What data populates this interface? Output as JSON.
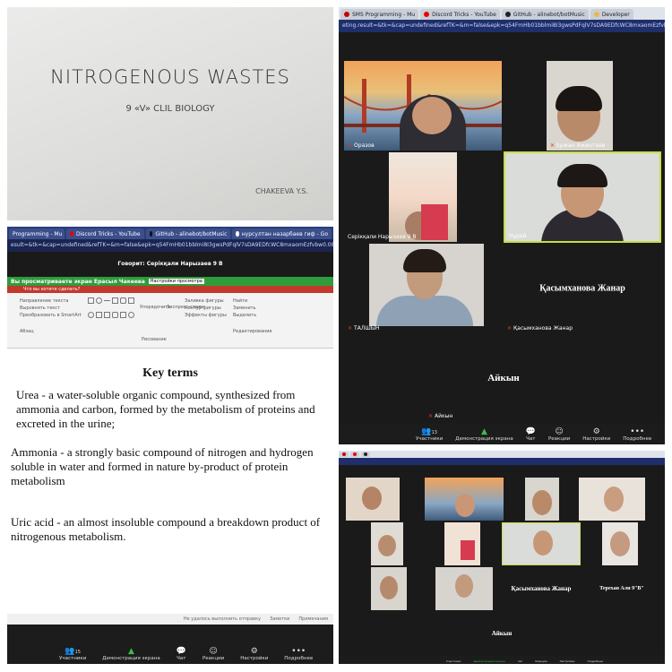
{
  "slide": {
    "title": "NITROGENOUS WASTES",
    "subtitle": "9 «V» CLIL BIOLOGY",
    "author": "CHAKEEVA Y.S."
  },
  "zoom_top": {
    "tabs": [
      "SMS Programming - Mu",
      "Discord Tricks - YouTube",
      "GitHub - alinebot/botMusic",
      "Developer"
    ],
    "url": "eting.result=&tk=&cap=undefined&refTK=&m=false&epk=q54FmHb01bblmi8I3gwsPdFqlV7sDA9EDfcWC8mxaomEzfvbw0.085Y9F0F8",
    "participants": [
      {
        "name": "Оразов"
      },
      {
        "name": "Ержан Ажинтаев"
      },
      {
        "name": "Серікқали Нарызаев 9 В"
      },
      {
        "name": "Нұрай"
      },
      {
        "name": "ТАЛШЫН"
      },
      {
        "name": "Қасымханова Жанар",
        "big": "Қасымханова Жанар"
      },
      {
        "name": "Айкын",
        "big": "Айкын"
      }
    ],
    "toolbar": {
      "participants": "Участники",
      "participants_count": "13",
      "share": "Демонстрация экрана",
      "chat": "Чат",
      "reactions": "Реакции",
      "settings": "Настройки",
      "more": "Подробнее"
    }
  },
  "zoom_doc": {
    "tabs": [
      "Programming - Mu",
      "Discord Tricks - YouTube",
      "GitHub - alinebot/botMusic",
      "нурсултан назарбаев гиф - Go"
    ],
    "url": "esult=&tk=&cap=undefined&refTK=&m=false&epk=q54FmHb01bblmi8I3gwsPdFqlV7sDA9EDfcWC8mxaomEzfvbw0.085Y9F0F8",
    "speaker": "Говорит: Серікқали Нарызаев 9 В",
    "viewing": "Вы просматриваете экран Ерасыл Чакеева",
    "view_settings": "Настройки просмотра",
    "hint": "Что вы хотите сделать?",
    "ribbon": {
      "g1": [
        "Направление текста",
        "Выровнять текст",
        "Преобразовать в SmartArt"
      ],
      "g2": "Абзац",
      "arrange": "Упорядочить",
      "styles": "Экспресс-стили",
      "g3": [
        "Заливка фигуры",
        "Контур фигуры",
        "Эффекты фигуры"
      ],
      "drawing": "Рисование",
      "g4": [
        "Найти",
        "Заменить",
        "Выделить"
      ],
      "editing": "Редактирование"
    },
    "doc_title": "Key terms",
    "paragraphs": [
      "Urea - a water-soluble organic compound, synthesized from ammonia and carbon, formed by the metabolism of proteins and excreted in the urine;",
      "Ammonia - a strongly basic compound of nitrogen and hydrogen soluble in water and formed in nature by-product of protein metabolism",
      "Uric acid - an almost insoluble compound a breakdown product of nitrogenous metabolism."
    ],
    "status": {
      "msg": "Не удалось выполнить отправку",
      "notes": "Заметки",
      "comments": "Примечания"
    },
    "toolbar": {
      "participants": "Участники",
      "participants_count": "15",
      "share": "Демонстрация экрана",
      "chat": "Чат",
      "reactions": "Реакции",
      "settings": "Настройки",
      "more": "Подробнее"
    }
  },
  "zoom_grid": {
    "big_names": [
      "Қасымханова Жанар",
      "Терехан Али 9\"В\"",
      "Айкын"
    ],
    "toolbar": [
      "Участники",
      "Демонстрация экрана",
      "Чат",
      "Реакции",
      "Настройки",
      "Подробнее"
    ]
  }
}
